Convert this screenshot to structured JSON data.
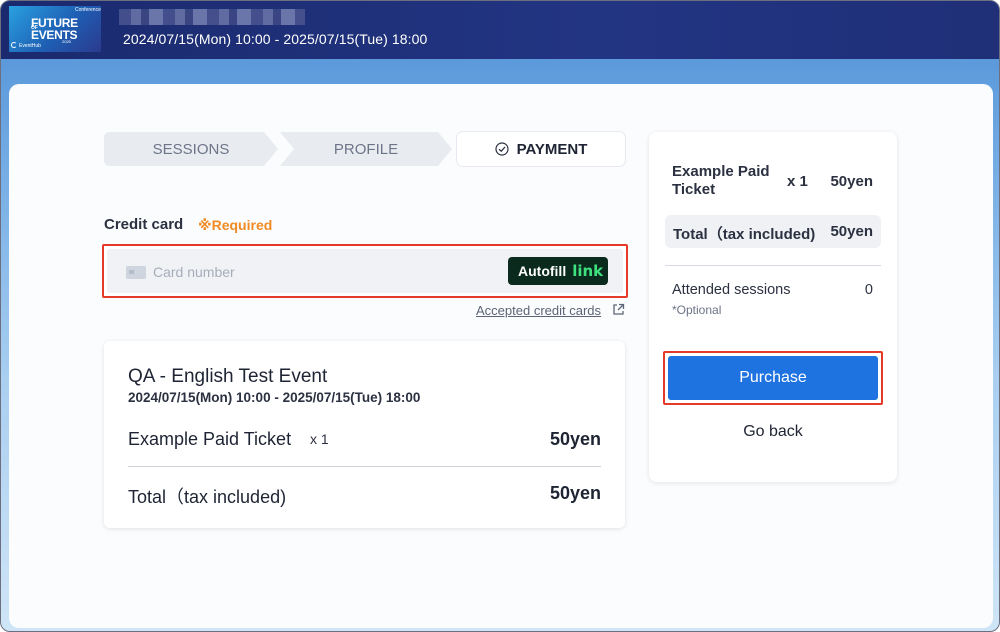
{
  "header": {
    "logo": {
      "line1": "FUTURE",
      "of": "OF",
      "line2": "EVENTS",
      "conference": "Conference",
      "year": "2025",
      "brand": "EventHub"
    },
    "event_dates": "2024/07/15(Mon) 10:00 - 2025/07/15(Tue) 18:00"
  },
  "steps": {
    "sessions": "SESSIONS",
    "profile": "PROFILE",
    "payment": "PAYMENT"
  },
  "credit_card": {
    "label": "Credit card",
    "required": "※Required",
    "placeholder": "Card number",
    "autofill_label": "Autofill",
    "autofill_link": "link",
    "accepted_link": "Accepted credit cards"
  },
  "order_summary": {
    "event_title": "QA - English Test Event",
    "event_dates": "2024/07/15(Mon) 10:00 - 2025/07/15(Tue) 18:00",
    "ticket_name": "Example Paid Ticket",
    "ticket_qty": "x 1",
    "ticket_price": "50yen",
    "total_label": "Total（tax included)",
    "total_price": "50yen"
  },
  "sidebar": {
    "ticket_name": "Example Paid Ticket",
    "ticket_qty": "x 1",
    "ticket_price": "50yen",
    "total_label": "Total（tax included)",
    "total_price": "50yen",
    "attended_label": "Attended sessions",
    "attended_count": "0",
    "optional": "*Optional",
    "purchase_label": "Purchase",
    "goback_label": "Go back"
  },
  "colors": {
    "primary": "#1f73e0",
    "highlight_border": "#e53a2a",
    "required": "#f08a24",
    "header_bg": "#1b2a6e",
    "link_green": "#3fe07e"
  }
}
